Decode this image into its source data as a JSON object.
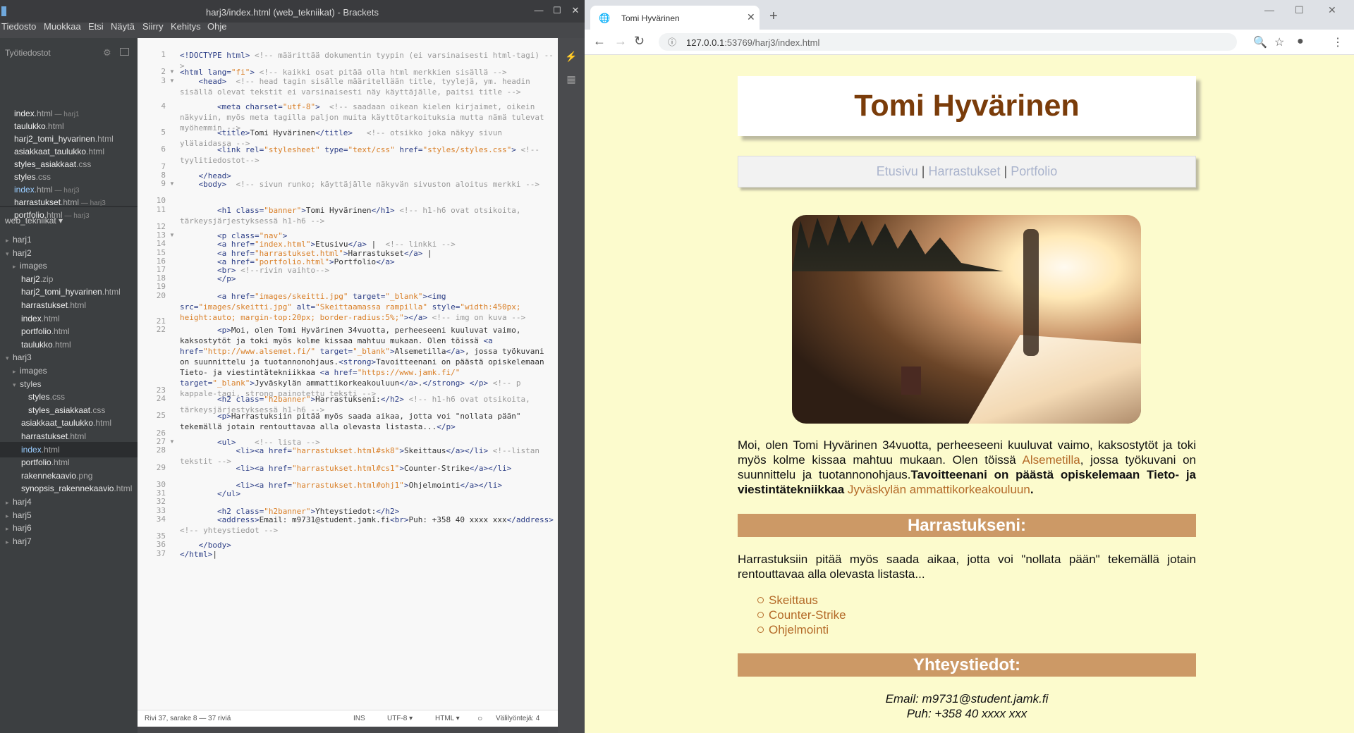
{
  "brackets": {
    "title": "harj3/index.html (web_tekniikat) - Brackets",
    "menu": [
      "Tiedosto",
      "Muokkaa",
      "Etsi",
      "Näytä",
      "Siirry",
      "Kehitys",
      "Ohje"
    ],
    "working_files_header": "Työtiedostot",
    "working_files": [
      {
        "name": "index",
        "ext": ".html",
        "dir": " — harj1"
      },
      {
        "name": "taulukko",
        "ext": ".html",
        "dir": ""
      },
      {
        "name": "harj2_tomi_hyvarinen",
        "ext": ".html",
        "dir": ""
      },
      {
        "name": "asiakkaat_taulukko",
        "ext": ".html",
        "dir": ""
      },
      {
        "name": "styles_asiakkaat",
        "ext": ".css",
        "dir": ""
      },
      {
        "name": "styles",
        "ext": ".css",
        "dir": ""
      },
      {
        "name": "index",
        "ext": ".html",
        "dir": " — harj3"
      },
      {
        "name": "harrastukset",
        "ext": ".html",
        "dir": " — harj3"
      },
      {
        "name": "portfolio",
        "ext": ".html",
        "dir": " — harj3"
      }
    ],
    "project_name": "web_tekniikat ▾",
    "tree": [
      {
        "name": "harj1",
        "ext": "",
        "indent": 0,
        "arrow": "▸",
        "folder": true
      },
      {
        "name": "harj2",
        "ext": "",
        "indent": 0,
        "arrow": "▾",
        "folder": true
      },
      {
        "name": "images",
        "ext": "",
        "indent": 1,
        "arrow": "▸",
        "folder": true
      },
      {
        "name": "harj2",
        "ext": ".zip",
        "indent": 1,
        "arrow": "",
        "folder": false
      },
      {
        "name": "harj2_tomi_hyvarinen",
        "ext": ".html",
        "indent": 1,
        "arrow": "",
        "folder": false
      },
      {
        "name": "harrastukset",
        "ext": ".html",
        "indent": 1,
        "arrow": "",
        "folder": false
      },
      {
        "name": "index",
        "ext": ".html",
        "indent": 1,
        "arrow": "",
        "folder": false
      },
      {
        "name": "portfolio",
        "ext": ".html",
        "indent": 1,
        "arrow": "",
        "folder": false
      },
      {
        "name": "taulukko",
        "ext": ".html",
        "indent": 1,
        "arrow": "",
        "folder": false
      },
      {
        "name": "harj3",
        "ext": "",
        "indent": 0,
        "arrow": "▾",
        "folder": true
      },
      {
        "name": "images",
        "ext": "",
        "indent": 1,
        "arrow": "▸",
        "folder": true
      },
      {
        "name": "styles",
        "ext": "",
        "indent": 1,
        "arrow": "▾",
        "folder": true
      },
      {
        "name": "styles",
        "ext": ".css",
        "indent": 2,
        "arrow": "",
        "folder": false
      },
      {
        "name": "styles_asiakkaat",
        "ext": ".css",
        "indent": 2,
        "arrow": "",
        "folder": false
      },
      {
        "name": "asiakkaat_taulukko",
        "ext": ".html",
        "indent": 1,
        "arrow": "",
        "folder": false
      },
      {
        "name": "harrastukset",
        "ext": ".html",
        "indent": 1,
        "arrow": "",
        "folder": false
      },
      {
        "name": "index",
        "ext": ".html",
        "indent": 1,
        "arrow": "",
        "folder": false,
        "selected": true
      },
      {
        "name": "portfolio",
        "ext": ".html",
        "indent": 1,
        "arrow": "",
        "folder": false
      },
      {
        "name": "rakennekaavio",
        "ext": ".png",
        "indent": 1,
        "arrow": "",
        "folder": false
      },
      {
        "name": "synopsis_rakennekaavio",
        "ext": ".html",
        "indent": 1,
        "arrow": "",
        "folder": false
      },
      {
        "name": "harj4",
        "ext": "",
        "indent": 0,
        "arrow": "▸",
        "folder": true
      },
      {
        "name": "harj5",
        "ext": "",
        "indent": 0,
        "arrow": "▸",
        "folder": true
      },
      {
        "name": "harj6",
        "ext": "",
        "indent": 0,
        "arrow": "▸",
        "folder": true
      },
      {
        "name": "harj7",
        "ext": "",
        "indent": 0,
        "arrow": "▸",
        "folder": true
      }
    ],
    "code_lines": [
      {
        "n": "1",
        "fold": "",
        "html": "<span class='t'>&lt;!DOCTYPE html&gt;</span> <span class='c'>&lt;!-- määrittää dokumentin tyypin (ei varsinaisesti html-tagi) --&gt;</span>"
      },
      {
        "n": "2",
        "fold": "▼",
        "html": "<span class='t'>&lt;html</span> <span class='a'>lang=</span><span class='s'>\"fi\"</span><span class='t'>&gt;</span> <span class='c'>&lt;!-- kaikki osat pitää olla html merkkien sisällä --&gt;</span>"
      },
      {
        "n": "3",
        "fold": "▼",
        "html": "    <span class='t'>&lt;head&gt;</span>  <span class='c'>&lt;!-- head tagin sisälle määritellään title, tyylejä, ym. headin sisällä olevat tekstit ei varsinaisesti näy käyttäjälle, paitsi title --&gt;</span>"
      },
      {
        "n": "4",
        "fold": "",
        "html": "        <span class='t'>&lt;meta</span> <span class='a'>charset=</span><span class='s'>\"utf-8\"</span><span class='t'>&gt;</span>  <span class='c'>&lt;!-- saadaan oikean kielen kirjaimet, oikein näkyviin, myös meta tagilla paljon muita käyttötarkoituksia mutta nämä tulevat myöhemmin --&gt;</span>"
      },
      {
        "n": "5",
        "fold": "",
        "html": "        <span class='t'>&lt;title&gt;</span>Tomi Hyvärinen<span class='t'>&lt;/title&gt;</span>   <span class='c'>&lt;!-- otsikko joka näkyy sivun ylälaidassa --&gt;</span>"
      },
      {
        "n": "6",
        "fold": "",
        "html": "        <span class='t'>&lt;link</span> <span class='a'>rel=</span><span class='s'>\"stylesheet\"</span> <span class='a'>type=</span><span class='s'>\"text/css\"</span> <span class='a'>href=</span><span class='s'>\"styles/styles.css\"</span><span class='t'>&gt;</span> <span class='c'>&lt;!--tyylitiedostot--&gt;</span>"
      },
      {
        "n": "7",
        "fold": "",
        "html": ""
      },
      {
        "n": "8",
        "fold": "",
        "html": "    <span class='t'>&lt;/head&gt;</span>"
      },
      {
        "n": "9",
        "fold": "▼",
        "html": "    <span class='t'>&lt;body&gt;</span>  <span class='c'>&lt;!-- sivun runko; käyttäjälle näkyvän sivuston aloitus merkki --&gt;</span>"
      },
      {
        "n": "10",
        "fold": "",
        "html": ""
      },
      {
        "n": "11",
        "fold": "",
        "html": "        <span class='t'>&lt;h1</span> <span class='a'>class=</span><span class='s'>\"banner\"</span><span class='t'>&gt;</span>Tomi Hyvärinen<span class='t'>&lt;/h1&gt;</span> <span class='c'>&lt;!-- h1-h6 ovat otsikoita, tärkeysjärjestyksessä h1-h6 --&gt;</span>"
      },
      {
        "n": "12",
        "fold": "",
        "html": ""
      },
      {
        "n": "13",
        "fold": "▼",
        "html": "        <span class='t'>&lt;p</span> <span class='a'>class=</span><span class='s'>\"nav\"</span><span class='t'>&gt;</span>"
      },
      {
        "n": "14",
        "fold": "",
        "html": "        <span class='t'>&lt;a</span> <span class='a'>href=</span><span class='s'>\"index.html\"</span><span class='t'>&gt;</span>Etusivu<span class='t'>&lt;/a&gt;</span> |  <span class='c'>&lt;!-- linkki --&gt;</span>"
      },
      {
        "n": "15",
        "fold": "",
        "html": "        <span class='t'>&lt;a</span> <span class='a'>href=</span><span class='s'>\"harrastukset.html\"</span><span class='t'>&gt;</span>Harrastukset<span class='t'>&lt;/a&gt;</span> |"
      },
      {
        "n": "16",
        "fold": "",
        "html": "        <span class='t'>&lt;a</span> <span class='a'>href=</span><span class='s'>\"portfolio.html\"</span><span class='t'>&gt;</span>Portfolio<span class='t'>&lt;/a&gt;</span>"
      },
      {
        "n": "17",
        "fold": "",
        "html": "        <span class='t'>&lt;br&gt;</span> <span class='c'>&lt;!--rivin vaihto--&gt;</span>"
      },
      {
        "n": "18",
        "fold": "",
        "html": "        <span class='t'>&lt;/p&gt;</span>"
      },
      {
        "n": "19",
        "fold": "",
        "html": ""
      },
      {
        "n": "20",
        "fold": "",
        "html": "        <span class='t'>&lt;a</span> <span class='a'>href=</span><span class='s'>\"images/skeitti.jpg\"</span> <span class='a'>target=</span><span class='s'>\"_blank\"</span><span class='t'>&gt;&lt;img</span> <span class='a'>src=</span><span class='s'>\"images/skeitti.jpg\"</span> <span class='a'>alt=</span><span class='s'>\"Skeittaamassa rampilla\"</span> <span class='a'>style=</span><span class='s'>\"width:450px; height:auto; margin-top:20px; border-radius:5%;\"</span><span class='t'>&gt;&lt;/a&gt;</span> <span class='c'>&lt;!-- img on kuva --&gt;</span>"
      },
      {
        "n": "21",
        "fold": "",
        "html": ""
      },
      {
        "n": "22",
        "fold": "",
        "html": "        <span class='t'>&lt;p&gt;</span>Moi, olen Tomi Hyvärinen 34vuotta, perheeseeni kuuluvat vaimo, kaksostytöt ja toki myös kolme kissaa mahtuu mukaan. Olen töissä <span class='t'>&lt;a</span> <span class='a'>href=</span><span class='s'>\"http://www.alsemet.fi/\"</span> <span class='a'>target=</span><span class='s'>\"_blank\"</span><span class='t'>&gt;</span>Alsemetilla<span class='t'>&lt;/a&gt;</span>, jossa työkuvani on suunnittelu ja tuotannonohjaus.<span class='t'>&lt;strong&gt;</span>Tavoitteenani on päästä opiskelemaan Tieto- ja viestintätekniikkaa <span class='t'>&lt;a</span> <span class='a'>href=</span><span class='s'>\"https://www.jamk.fi/\"</span> <span class='a'>target=</span><span class='s'>\"_blank\"</span><span class='t'>&gt;</span>Jyväskylän ammattikorkeakouluun<span class='t'>&lt;/a&gt;</span>.<span class='t'>&lt;/strong&gt;</span> <span class='t'>&lt;/p&gt;</span> <span class='c'>&lt;!-- p kappale-tagi, strong painotettu teksti --&gt;</span>"
      },
      {
        "n": "23",
        "fold": "",
        "html": ""
      },
      {
        "n": "24",
        "fold": "",
        "html": "        <span class='t'>&lt;h2</span> <span class='a'>class=</span><span class='s'>\"h2banner\"</span><span class='t'>&gt;</span>Harrastukseni:<span class='t'>&lt;/h2&gt;</span> <span class='c'>&lt;!-- h1-h6 ovat otsikoita, tärkeysjärjestyksessä h1-h6 --&gt;</span>"
      },
      {
        "n": "25",
        "fold": "",
        "html": "        <span class='t'>&lt;p&gt;</span>Harrastuksiin pitää myös saada aikaa, jotta voi \"nollata pään\" tekemällä jotain rentouttavaa alla olevasta listasta...<span class='t'>&lt;/p&gt;</span>"
      },
      {
        "n": "26",
        "fold": "",
        "html": ""
      },
      {
        "n": "27",
        "fold": "▼",
        "html": "        <span class='t'>&lt;ul&gt;</span>    <span class='c'>&lt;!-- lista --&gt;</span>"
      },
      {
        "n": "28",
        "fold": "",
        "html": "            <span class='t'>&lt;li&gt;&lt;a</span> <span class='a'>href=</span><span class='s'>\"harrastukset.html#sk8\"</span><span class='t'>&gt;</span>Skeittaus<span class='t'>&lt;/a&gt;&lt;/li&gt;</span> <span class='c'>&lt;!--listan tekstit --&gt;</span>"
      },
      {
        "n": "29",
        "fold": "",
        "html": "            <span class='t'>&lt;li&gt;&lt;a</span> <span class='a'>href=</span><span class='s'>\"harrastukset.html#cs1\"</span><span class='t'>&gt;</span>Counter-Strike<span class='t'>&lt;/a&gt;&lt;/li&gt;</span>"
      },
      {
        "n": "30",
        "fold": "",
        "html": "            <span class='t'>&lt;li&gt;&lt;a</span> <span class='a'>href=</span><span class='s'>\"harrastukset.html#ohj1\"</span><span class='t'>&gt;</span>Ohjelmointi<span class='t'>&lt;/a&gt;&lt;/li&gt;</span>"
      },
      {
        "n": "31",
        "fold": "",
        "html": "        <span class='t'>&lt;/ul&gt;</span>"
      },
      {
        "n": "32",
        "fold": "",
        "html": ""
      },
      {
        "n": "33",
        "fold": "",
        "html": "        <span class='t'>&lt;h2</span> <span class='a'>class=</span><span class='s'>\"h2banner\"</span><span class='t'>&gt;</span>Yhteystiedot:<span class='t'>&lt;/h2&gt;</span>"
      },
      {
        "n": "34",
        "fold": "",
        "html": "        <span class='t'>&lt;address&gt;</span>Email: m9731@student.jamk.fi<span class='t'>&lt;br&gt;</span>Puh: +358 40 xxxx xxx<span class='t'>&lt;/address&gt;</span> <span class='c'>&lt;!-- yhteystiedot --&gt;</span>"
      },
      {
        "n": "35",
        "fold": "",
        "html": ""
      },
      {
        "n": "36",
        "fold": "",
        "html": "    <span class='t'>&lt;/body&gt;</span>"
      },
      {
        "n": "37",
        "fold": "",
        "html": "<span class='t'>&lt;/html&gt;</span>|"
      }
    ],
    "status": {
      "position": "Rivi 37, sarake 8 — 37 riviä",
      "mode": "INS",
      "encoding": "UTF-8 ▾",
      "language": "HTML ▾",
      "indent": "Välilyöntejä: 4"
    }
  },
  "chrome": {
    "tab_title": "Tomi Hyvärinen",
    "url_host": "127.0.0.1",
    "url_path": ":53769/harj3/index.html"
  },
  "page": {
    "banner": "Tomi Hyvärinen",
    "nav": [
      "Etusivu",
      "Harrastukset",
      "Portfolio"
    ],
    "nav_sep": " | ",
    "intro_1": "Moi, olen Tomi Hyvärinen 34vuotta, perheeseeni kuuluvat vaimo, kaksostytöt ja toki myös kolme kissaa mahtuu mukaan. Olen töissä ",
    "intro_link_1": "Alsemetilla",
    "intro_2": ", jossa työkuvani on suunnittelu ja tuotannonohjaus.",
    "intro_strong": "Tavoitteenani on päästä opiskelemaan Tieto- ja viestintätekniikkaa ",
    "intro_link_2": "Jyväskylän ammattikorkeakouluun",
    "intro_end": ".",
    "h2_hobbies": "Harrastukseni:",
    "hobbies_text": "Harrastuksiin pitää myös saada aikaa, jotta voi \"nollata pään\" tekemällä jotain rentouttavaa alla olevasta listasta...",
    "hobbies": [
      "Skeittaus",
      "Counter-Strike",
      "Ohjelmointi"
    ],
    "h2_contact": "Yhteystiedot:",
    "email": "Email: m9731@student.jamk.fi",
    "phone": "Puh: +358 40 xxxx xxx"
  }
}
